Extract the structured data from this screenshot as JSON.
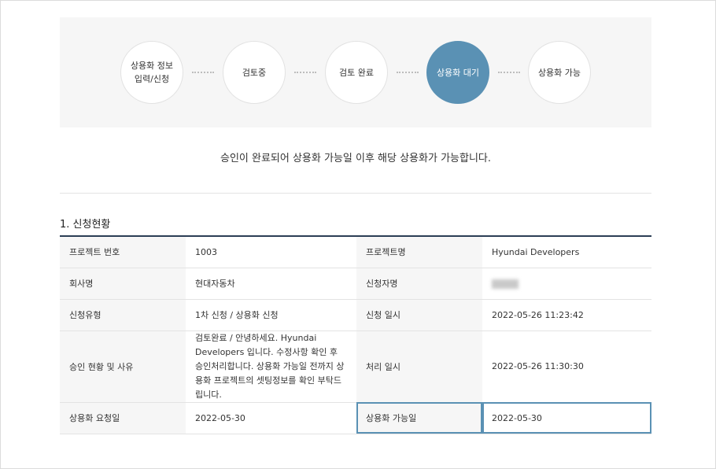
{
  "steps": [
    {
      "label": "상용화 정보\n입력/신청",
      "active": false
    },
    {
      "label": "검토중",
      "active": false
    },
    {
      "label": "검토 완료",
      "active": false
    },
    {
      "label": "상용화 대기",
      "active": true
    },
    {
      "label": "상용화 가능",
      "active": false
    }
  ],
  "notice": "승인이 완료되어 상용화 가능일 이후 해당 상용화가 가능합니다.",
  "section_title": "1. 신청현황",
  "rows": [
    {
      "label1": "프로젝트 번호",
      "value1": "1003",
      "label2": "프로젝트명",
      "value2": "Hyundai Developers"
    },
    {
      "label1": "회사명",
      "value1": "현대자동차",
      "label2": "신청자명",
      "value2": ""
    },
    {
      "label1": "신청유형",
      "value1": "1차 신청 / 상용화 신청",
      "label2": "신청 일시",
      "value2": "2022-05-26 11:23:42"
    },
    {
      "label1": "승인 현황 및 사유",
      "value1": "검토완료 / 안녕하세요. Hyundai Developers 입니다. 수정사항 확인 후 승인처리합니다. 상용화 가능일 전까지 상용화 프로젝트의 셋팅정보를 확인 부탁드립니다.",
      "label2": "처리 일시",
      "value2": "2022-05-26 11:30:30"
    },
    {
      "label1": "상용화 요청일",
      "value1": "2022-05-30",
      "label2": "상용화 가능일",
      "value2": "2022-05-30"
    }
  ],
  "colors": {
    "accent": "#5a91b4",
    "header_line": "#2c3e55",
    "reason_text": "#d0021b"
  }
}
